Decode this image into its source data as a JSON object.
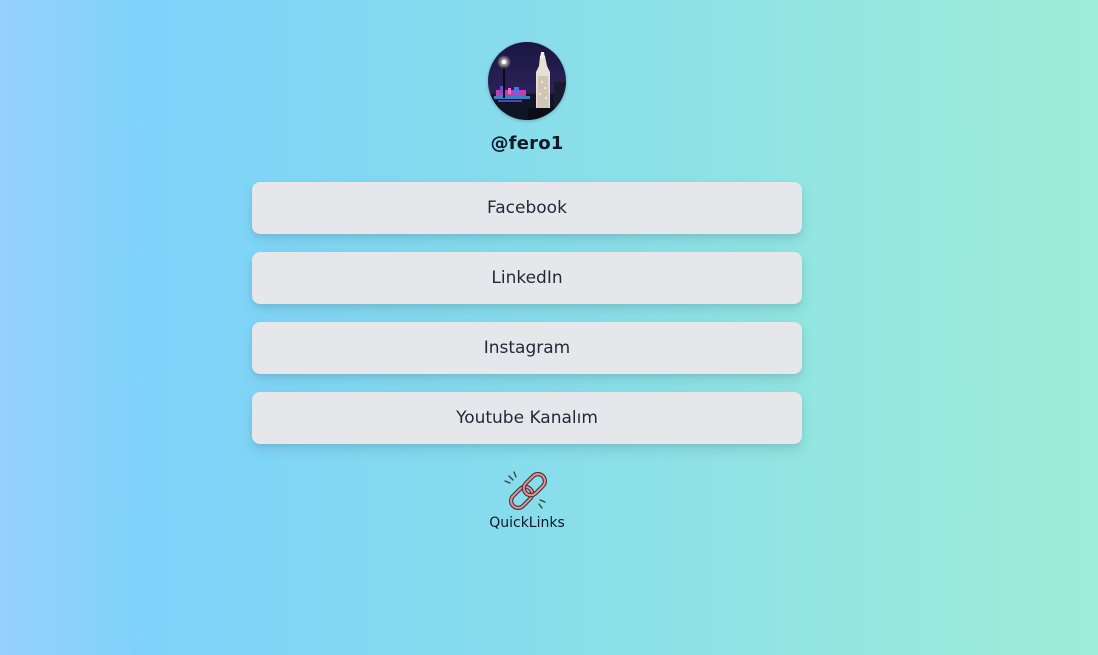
{
  "profile": {
    "username": "@fero1",
    "avatar_icon": "night-city-photo-avatar"
  },
  "links": [
    {
      "label": "Facebook"
    },
    {
      "label": "LinkedIn"
    },
    {
      "label": "Instagram"
    },
    {
      "label": "Youtube Kanalım"
    }
  ],
  "footer": {
    "brand": "QuickLinks",
    "logo_icon": "chain-link-icon"
  },
  "colors": {
    "background_start": "#96d0ff",
    "background_end": "#9eedd8",
    "button_bg": "#e5e7eb",
    "logo_accent": "#e26a78"
  }
}
